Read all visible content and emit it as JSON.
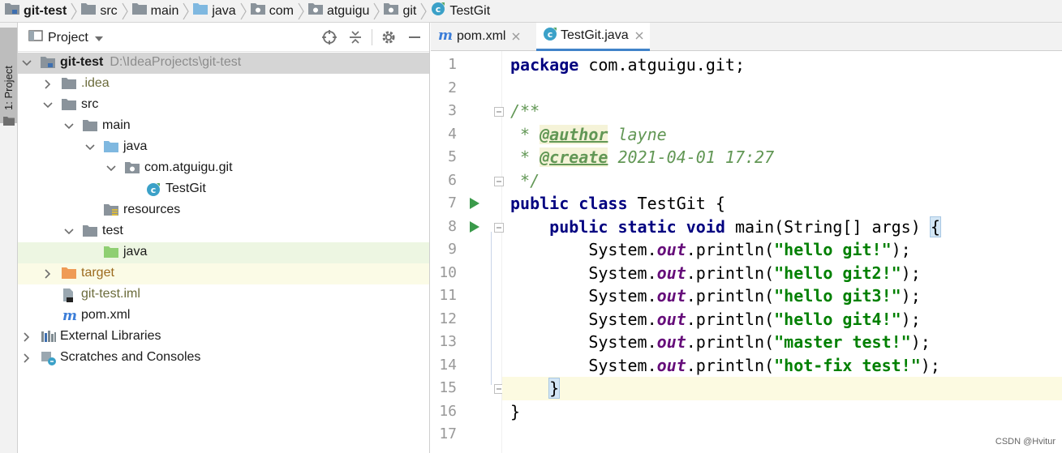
{
  "breadcrumb": [
    {
      "label": "git-test",
      "icon": "module-folder-icon",
      "bold": true
    },
    {
      "label": "src",
      "icon": "folder-icon"
    },
    {
      "label": "main",
      "icon": "folder-icon"
    },
    {
      "label": "java",
      "icon": "source-folder-icon"
    },
    {
      "label": "com",
      "icon": "package-icon"
    },
    {
      "label": "atguigu",
      "icon": "package-icon"
    },
    {
      "label": "git",
      "icon": "package-icon"
    },
    {
      "label": "TestGit",
      "icon": "java-class-icon"
    }
  ],
  "toolstrip": {
    "project_tab": "1: Project"
  },
  "project_panel": {
    "title": "Project",
    "tools": [
      "locate-icon",
      "collapse-all-icon",
      "gear-icon",
      "minimize-icon"
    ],
    "tree": [
      {
        "label": "git-test",
        "path": "D:\\IdeaProjects\\git-test",
        "icon": "module-folder-icon",
        "expanded": true,
        "level": 0
      },
      {
        "label": ".idea",
        "icon": "folder-icon",
        "expanded": false,
        "level": 1
      },
      {
        "label": "src",
        "icon": "folder-icon",
        "expanded": true,
        "level": 1
      },
      {
        "label": "main",
        "icon": "folder-icon",
        "expanded": true,
        "level": 2
      },
      {
        "label": "java",
        "icon": "source-folder-icon",
        "expanded": true,
        "level": 3
      },
      {
        "label": "com.atguigu.git",
        "icon": "package-icon",
        "expanded": true,
        "level": 4
      },
      {
        "label": "TestGit",
        "icon": "java-class-icon",
        "level": 5
      },
      {
        "label": "resources",
        "icon": "resources-folder-icon",
        "level": 3
      },
      {
        "label": "test",
        "icon": "folder-icon",
        "expanded": true,
        "level": 2
      },
      {
        "label": "java",
        "icon": "test-source-folder-icon",
        "level": 3
      },
      {
        "label": "target",
        "icon": "excluded-folder-icon",
        "expanded": false,
        "level": 1
      },
      {
        "label": "git-test.iml",
        "icon": "iml-file-icon",
        "level": 1
      },
      {
        "label": "pom.xml",
        "icon": "maven-icon",
        "level": 1
      },
      {
        "label": "External Libraries",
        "icon": "libraries-icon",
        "expanded": false,
        "level": 0
      },
      {
        "label": "Scratches and Consoles",
        "icon": "scratches-icon",
        "expanded": false,
        "level": 0
      }
    ]
  },
  "editor": {
    "tabs": [
      {
        "label": "pom.xml",
        "icon": "maven-icon",
        "active": false
      },
      {
        "label": "TestGit.java",
        "icon": "java-class-icon",
        "active": true
      }
    ],
    "lines": [
      {
        "n": "1",
        "text": "package com.atguigu.git;"
      },
      {
        "n": "2",
        "text": ""
      },
      {
        "n": "3",
        "text": "/**"
      },
      {
        "n": "4",
        "text": " * @author layne"
      },
      {
        "n": "5",
        "text": " * @create 2021-04-01 17:27"
      },
      {
        "n": "6",
        "text": " */"
      },
      {
        "n": "7",
        "text": "public class TestGit {"
      },
      {
        "n": "8",
        "text": "    public static void main(String[] args) {"
      },
      {
        "n": "9",
        "text": "        System.out.println(\"hello git!\");"
      },
      {
        "n": "10",
        "text": "        System.out.println(\"hello git2!\");"
      },
      {
        "n": "11",
        "text": "        System.out.println(\"hello git3!\");"
      },
      {
        "n": "12",
        "text": "        System.out.println(\"hello git4!\");"
      },
      {
        "n": "13",
        "text": "        System.out.println(\"master test!\");"
      },
      {
        "n": "14",
        "text": "        System.out.println(\"hot-fix test!\");"
      },
      {
        "n": "15",
        "text": "    }"
      },
      {
        "n": "16",
        "text": "}"
      },
      {
        "n": "17",
        "text": ""
      }
    ],
    "current_line": "15"
  },
  "watermark": "CSDN @Hvitur",
  "colors": {
    "keyword": "#000080",
    "string": "#008000",
    "doc_comment": "#629755",
    "field": "#660e7a",
    "selection": "#d5d5d5",
    "current_line": "#fcfae1",
    "tab_underline": "#4083c9"
  }
}
